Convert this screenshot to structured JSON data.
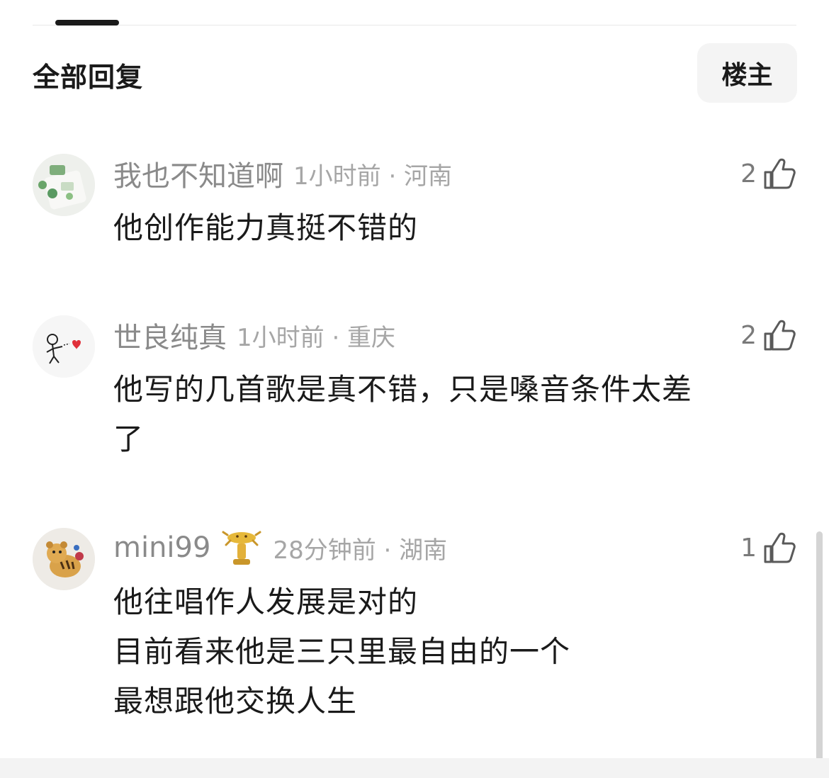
{
  "header": {
    "title": "全部回复",
    "filter_button": "楼主"
  },
  "comments": [
    {
      "username": "我也不知道啊",
      "meta": "1小时前 · 河南",
      "likes": "2",
      "text": "他创作能力真挺不错的",
      "avatar": "phone-case-photo"
    },
    {
      "username": "世良纯真",
      "meta": "1小时前 · 重庆",
      "likes": "2",
      "text": "他写的几首歌是真不错，只是嗓音条件太差\n了",
      "avatar": "stick-figure-heart"
    },
    {
      "username": "mini99",
      "meta": "28分钟前 · 湖南",
      "likes": "1",
      "text": "他往唱作人发展是对的\n目前看来他是三只里最自由的一个\n 最想跟他交换人生",
      "avatar": "tiger-toy",
      "badge": "golden-tiger-trophy-icon"
    }
  ],
  "icons": {
    "like": "thumbs-up-icon"
  },
  "colors": {
    "username": "#8a8a8a",
    "meta": "#a6a6a6",
    "text": "#1a1a1a",
    "button_bg": "#f4f4f4"
  }
}
